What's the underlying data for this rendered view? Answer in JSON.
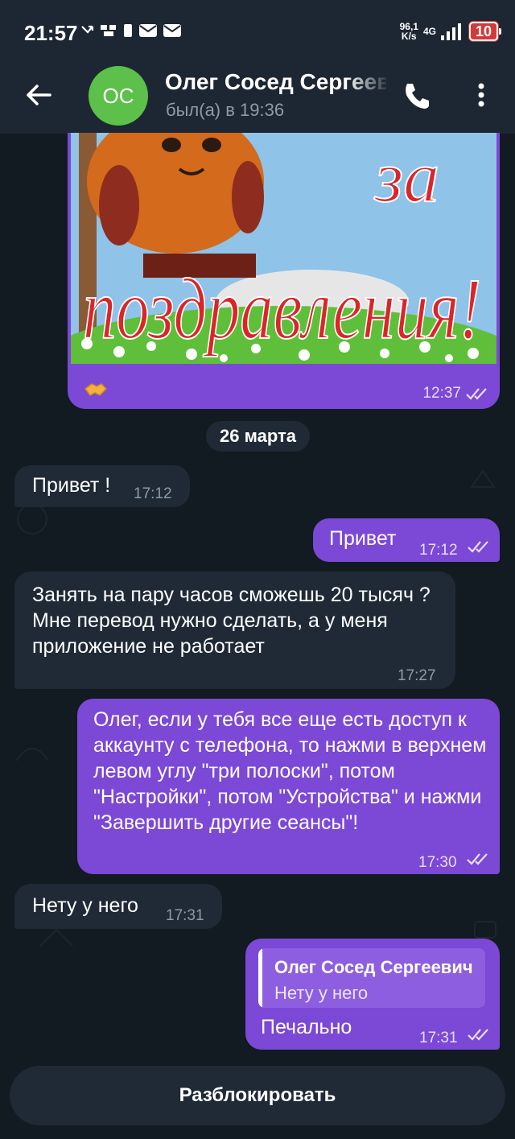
{
  "status_bar": {
    "time": "21:57",
    "speed_value": "96,1",
    "speed_unit": "K/s",
    "network": "4G",
    "battery": "10"
  },
  "header": {
    "avatar_initials": "ОС",
    "contact_name": "Олег Сосед Сергеевич",
    "last_seen": "был(а) в 19:36"
  },
  "photo_message": {
    "caption_line1": "за",
    "caption_line2": "поздравления!",
    "time": "12:37"
  },
  "date_separator": "26 марта",
  "messages": [
    {
      "direction": "in",
      "text": "Привет !",
      "time": "17:12"
    },
    {
      "direction": "out",
      "text": "Привет",
      "time": "17:12"
    },
    {
      "direction": "in",
      "text": "Занять на пару часов сможешь 20 тысяч ? Мне перевод нужно сделать, а у меня приложение не работает",
      "time": "17:27"
    },
    {
      "direction": "out",
      "text": "Олег, если у тебя все еще есть доступ к аккаунту с телефона, то нажми в верхнем левом углу \"три полоски\", потом \"Настройки\", потом \"Устройства\" и нажми \"Завершить другие сеансы\"!",
      "time": "17:30"
    },
    {
      "direction": "in",
      "text": "Нету у него",
      "time": "17:31"
    },
    {
      "direction": "out",
      "text": "Печально",
      "time": "17:31",
      "reply_to": {
        "name": "Олег Сосед Сергеевич",
        "text": "Нету у него"
      }
    }
  ],
  "footer": {
    "unblock_label": "Разблокировать"
  },
  "colors": {
    "background": "#121a22",
    "header": "#1d2733",
    "incoming_bubble": "#1f2a36",
    "outgoing_bubble": "#7c48d6",
    "avatar": "#5cc04a"
  }
}
